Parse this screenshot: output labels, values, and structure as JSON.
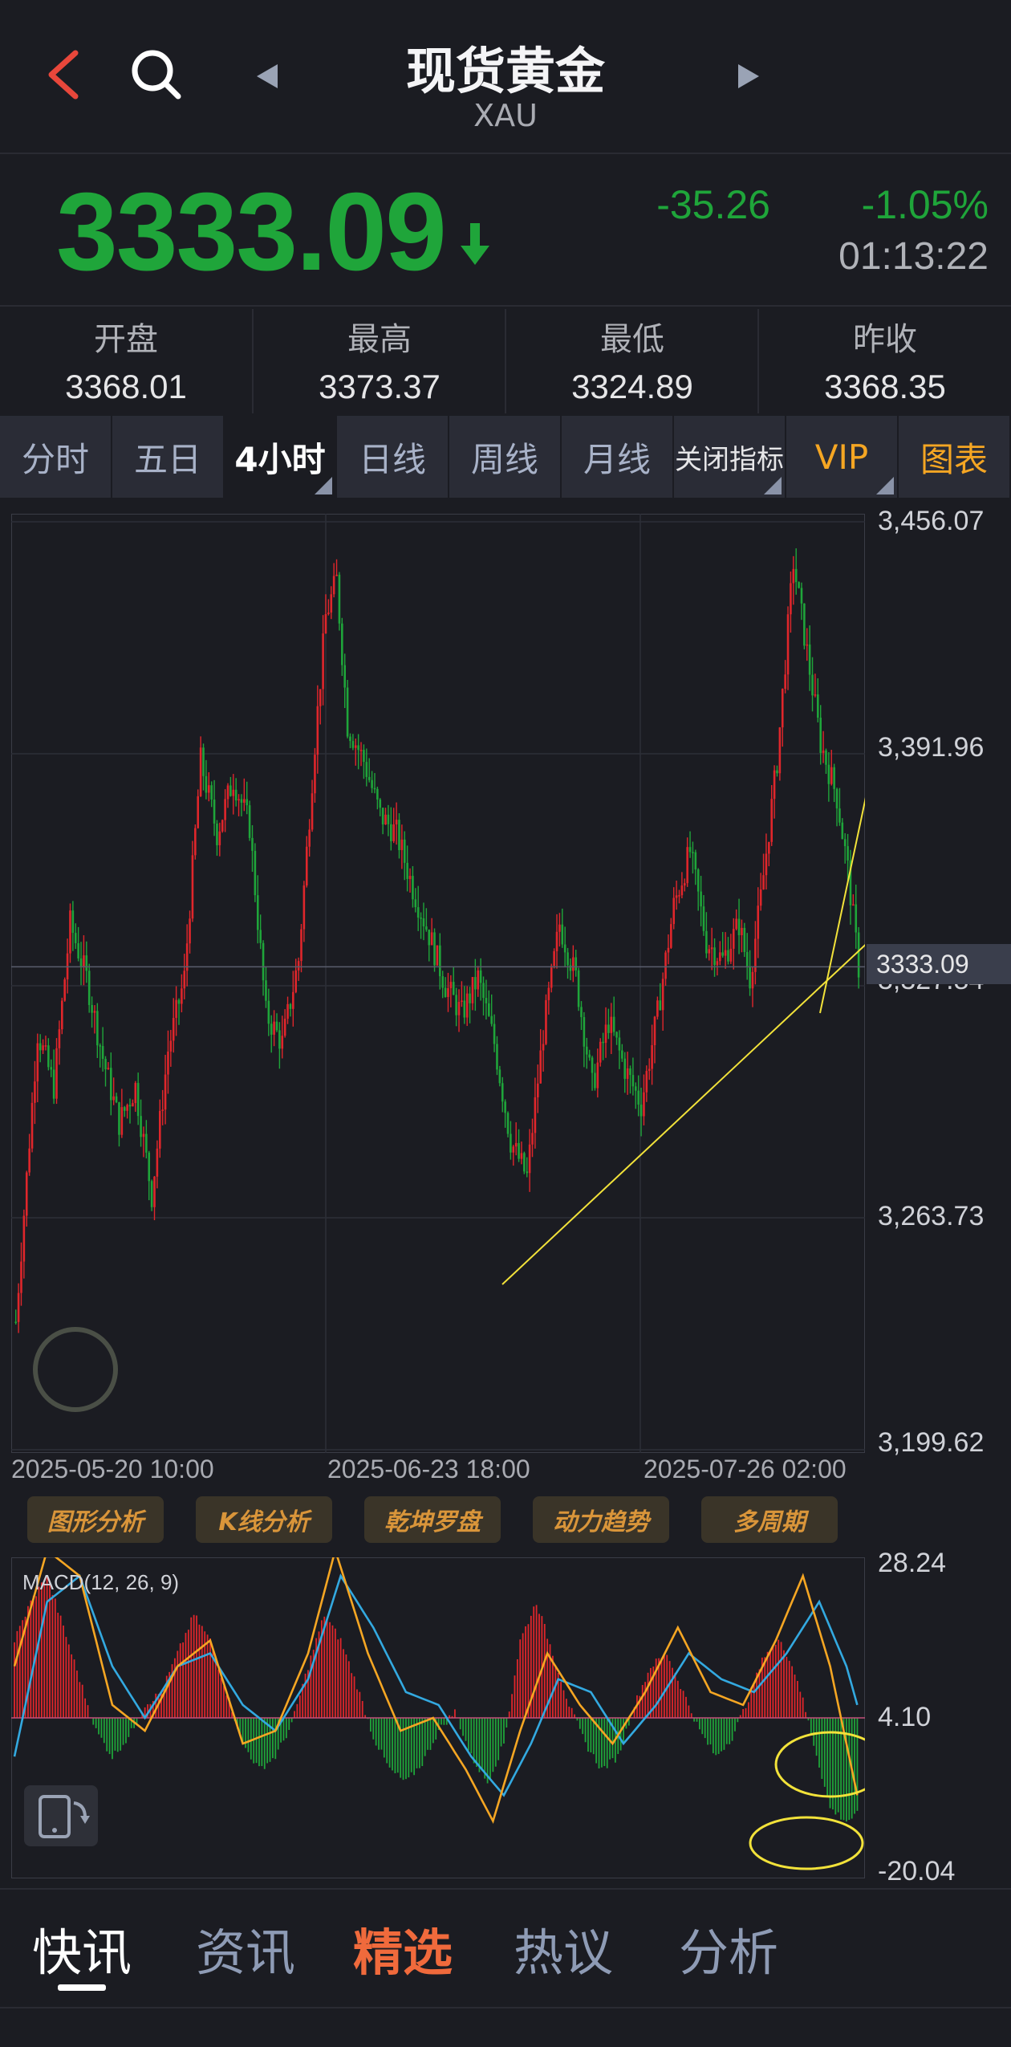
{
  "header": {
    "title": "现货黄金",
    "symbol": "XAU"
  },
  "quote": {
    "price": "3333.09",
    "change": "-35.26",
    "change_pct": "-1.05%",
    "time": "01:13:22",
    "direction": "down"
  },
  "stats": [
    {
      "label": "开盘",
      "value": "3368.01"
    },
    {
      "label": "最高",
      "value": "3373.37"
    },
    {
      "label": "最低",
      "value": "3324.89"
    },
    {
      "label": "昨收",
      "value": "3368.35"
    }
  ],
  "tabs": [
    "分时",
    "五日",
    "4小时",
    "日线",
    "周线",
    "月线",
    "关闭指标",
    "VIP",
    "图表"
  ],
  "active_tab": "4小时",
  "price_axis": [
    "3,456.07",
    "3,391.96",
    "3,327.84",
    "3,263.73",
    "3,199.62"
  ],
  "current_price_tag": "3333.09",
  "x_labels": [
    "2025-05-20 10:00",
    "2025-06-23 18:00",
    "2025-07-26 02:00"
  ],
  "tools": [
    "图形分析",
    "K线分析",
    "乾坤罗盘",
    "动力趋势",
    "多周期"
  ],
  "macd": {
    "label": "MACD(12, 26, 9)",
    "axis": [
      "28.24",
      "4.10",
      "-20.04"
    ]
  },
  "bottom_nav": [
    "快讯",
    "资讯",
    "精选",
    "热议",
    "分析"
  ],
  "colors": {
    "up": "#e0262b",
    "down": "#1fa53a",
    "accent": "#f5a623",
    "annotation": "#f2e23a",
    "dif": "#f5a623",
    "dea": "#33a9e0"
  },
  "chart_data": {
    "type": "candlestick",
    "ylim": [
      3199.62,
      3456.07
    ],
    "x_ticks": [
      "2025-05-20 10:00",
      "2025-06-23 18:00",
      "2025-07-26 02:00"
    ],
    "y_ticks": [
      3456.07,
      3391.96,
      3327.84,
      3263.73,
      3199.62
    ],
    "last_price": 3333.09,
    "close_path": [
      [
        0,
        3235
      ],
      [
        8,
        3315
      ],
      [
        14,
        3300
      ],
      [
        20,
        3345
      ],
      [
        26,
        3330
      ],
      [
        32,
        3308
      ],
      [
        38,
        3290
      ],
      [
        44,
        3300
      ],
      [
        50,
        3270
      ],
      [
        56,
        3310
      ],
      [
        62,
        3330
      ],
      [
        68,
        3390
      ],
      [
        74,
        3370
      ],
      [
        80,
        3385
      ],
      [
        86,
        3372
      ],
      [
        92,
        3320
      ],
      [
        98,
        3312
      ],
      [
        104,
        3335
      ],
      [
        110,
        3395
      ],
      [
        114,
        3430
      ],
      [
        118,
        3440
      ],
      [
        122,
        3400
      ],
      [
        128,
        3390
      ],
      [
        134,
        3375
      ],
      [
        140,
        3370
      ],
      [
        146,
        3355
      ],
      [
        152,
        3342
      ],
      [
        158,
        3328
      ],
      [
        164,
        3320
      ],
      [
        170,
        3330
      ],
      [
        176,
        3312
      ],
      [
        182,
        3285
      ],
      [
        188,
        3275
      ],
      [
        194,
        3315
      ],
      [
        200,
        3345
      ],
      [
        206,
        3330
      ],
      [
        212,
        3300
      ],
      [
        218,
        3318
      ],
      [
        224,
        3305
      ],
      [
        230,
        3295
      ],
      [
        236,
        3320
      ],
      [
        242,
        3350
      ],
      [
        248,
        3365
      ],
      [
        254,
        3340
      ],
      [
        260,
        3335
      ],
      [
        266,
        3345
      ],
      [
        270,
        3330
      ],
      [
        274,
        3352
      ],
      [
        280,
        3390
      ],
      [
        286,
        3445
      ],
      [
        290,
        3425
      ],
      [
        296,
        3395
      ],
      [
        302,
        3380
      ],
      [
        306,
        3360
      ],
      [
        310,
        3333
      ]
    ],
    "macd_range": [
      -20.04,
      28.24
    ],
    "macd_zero": 4.1,
    "macd_hist": [
      [
        0,
        12
      ],
      [
        6,
        18
      ],
      [
        12,
        22
      ],
      [
        18,
        14
      ],
      [
        24,
        6
      ],
      [
        30,
        -2
      ],
      [
        36,
        -6
      ],
      [
        42,
        -3
      ],
      [
        48,
        2
      ],
      [
        54,
        4
      ],
      [
        60,
        10
      ],
      [
        66,
        16
      ],
      [
        72,
        12
      ],
      [
        78,
        4
      ],
      [
        84,
        -4
      ],
      [
        90,
        -8
      ],
      [
        96,
        -6
      ],
      [
        102,
        -1
      ],
      [
        108,
        8
      ],
      [
        114,
        16
      ],
      [
        120,
        12
      ],
      [
        126,
        5
      ],
      [
        132,
        -3
      ],
      [
        138,
        -8
      ],
      [
        144,
        -10
      ],
      [
        150,
        -7
      ],
      [
        156,
        -2
      ],
      [
        162,
        1
      ],
      [
        168,
        -6
      ],
      [
        174,
        -10
      ],
      [
        180,
        -4
      ],
      [
        186,
        12
      ],
      [
        192,
        18
      ],
      [
        198,
        10
      ],
      [
        204,
        2
      ],
      [
        210,
        -4
      ],
      [
        216,
        -8
      ],
      [
        222,
        -6
      ],
      [
        228,
        2
      ],
      [
        234,
        8
      ],
      [
        240,
        10
      ],
      [
        246,
        4
      ],
      [
        252,
        -2
      ],
      [
        258,
        -6
      ],
      [
        264,
        -3
      ],
      [
        270,
        3
      ],
      [
        276,
        10
      ],
      [
        282,
        12
      ],
      [
        288,
        6
      ],
      [
        294,
        -4
      ],
      [
        300,
        -14
      ],
      [
        306,
        -16
      ],
      [
        310,
        -15
      ]
    ],
    "macd_dif": [
      [
        0,
        8
      ],
      [
        12,
        26
      ],
      [
        24,
        22
      ],
      [
        36,
        2
      ],
      [
        48,
        -2
      ],
      [
        60,
        8
      ],
      [
        72,
        12
      ],
      [
        84,
        -4
      ],
      [
        96,
        -2
      ],
      [
        108,
        10
      ],
      [
        118,
        26
      ],
      [
        130,
        10
      ],
      [
        142,
        -2
      ],
      [
        154,
        0
      ],
      [
        166,
        -8
      ],
      [
        176,
        -16
      ],
      [
        186,
        -2
      ],
      [
        196,
        10
      ],
      [
        208,
        2
      ],
      [
        220,
        -4
      ],
      [
        232,
        4
      ],
      [
        244,
        14
      ],
      [
        256,
        4
      ],
      [
        268,
        2
      ],
      [
        280,
        12
      ],
      [
        290,
        22
      ],
      [
        300,
        8
      ],
      [
        310,
        -12
      ]
    ],
    "macd_dea": [
      [
        0,
        -6
      ],
      [
        12,
        18
      ],
      [
        24,
        22
      ],
      [
        36,
        8
      ],
      [
        48,
        0
      ],
      [
        60,
        8
      ],
      [
        72,
        10
      ],
      [
        84,
        2
      ],
      [
        96,
        -2
      ],
      [
        108,
        6
      ],
      [
        120,
        22
      ],
      [
        132,
        14
      ],
      [
        144,
        4
      ],
      [
        156,
        2
      ],
      [
        168,
        -6
      ],
      [
        180,
        -12
      ],
      [
        190,
        -4
      ],
      [
        200,
        6
      ],
      [
        212,
        4
      ],
      [
        224,
        -4
      ],
      [
        236,
        2
      ],
      [
        248,
        10
      ],
      [
        260,
        6
      ],
      [
        272,
        4
      ],
      [
        284,
        10
      ],
      [
        296,
        18
      ],
      [
        306,
        8
      ],
      [
        310,
        2
      ]
    ]
  }
}
